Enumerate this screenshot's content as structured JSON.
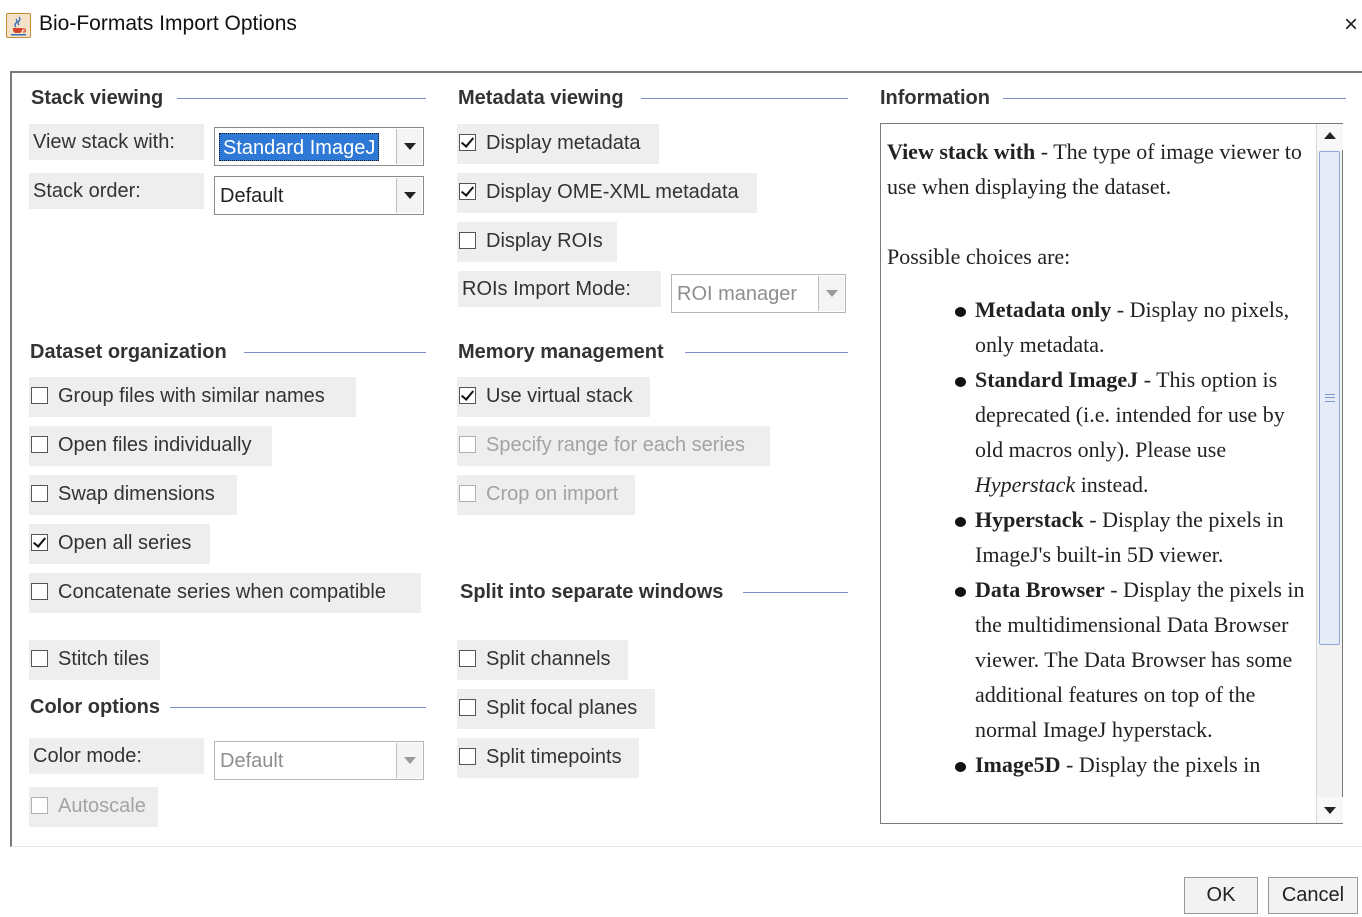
{
  "window": {
    "title": "Bio-Formats Import Options",
    "close_glyph": "×",
    "app_icon": "java-coffee-icon"
  },
  "stack_viewing": {
    "title": "Stack viewing",
    "view_stack_label": "View stack with:",
    "view_stack_value": "Standard ImageJ",
    "stack_order_label": "Stack order:",
    "stack_order_value": "Default"
  },
  "metadata_viewing": {
    "title": "Metadata viewing",
    "display_metadata": {
      "label": "Display metadata",
      "checked": true
    },
    "display_ome_xml": {
      "label": "Display OME-XML metadata",
      "checked": true
    },
    "display_rois": {
      "label": "Display ROIs",
      "checked": false
    },
    "rois_import_mode_label": "ROIs Import Mode:",
    "rois_import_mode_value": "ROI manager"
  },
  "dataset_organization": {
    "title": "Dataset organization",
    "group_files": {
      "label": "Group files with similar names",
      "checked": false
    },
    "open_individually": {
      "label": "Open files individually",
      "checked": false
    },
    "swap_dimensions": {
      "label": "Swap dimensions",
      "checked": false
    },
    "open_all_series": {
      "label": "Open all series",
      "checked": true
    },
    "concatenate": {
      "label": "Concatenate series when compatible",
      "checked": false
    },
    "stitch_tiles": {
      "label": "Stitch tiles",
      "checked": false
    }
  },
  "memory_management": {
    "title": "Memory management",
    "use_virtual_stack": {
      "label": "Use virtual stack",
      "checked": true
    },
    "specify_range": {
      "label": "Specify range for each series",
      "checked": false,
      "enabled": false
    },
    "crop_on_import": {
      "label": "Crop on import",
      "checked": false,
      "enabled": false
    }
  },
  "split_windows": {
    "title": "Split into separate windows",
    "split_channels": {
      "label": "Split channels",
      "checked": false
    },
    "split_focal_planes": {
      "label": "Split focal planes",
      "checked": false
    },
    "split_timepoints": {
      "label": "Split timepoints",
      "checked": false
    }
  },
  "color_options": {
    "title": "Color options",
    "color_mode_label": "Color mode:",
    "color_mode_value": "Default",
    "autoscale": {
      "label": "Autoscale",
      "checked": false,
      "enabled": false
    }
  },
  "information": {
    "title": "Information",
    "heading_term": "View stack with",
    "heading_desc": " - The type of image viewer to use when displaying the dataset.",
    "choices_intro": "Possible choices are:",
    "choices": [
      {
        "term": "Metadata only",
        "desc": " - Display no pixels, only metadata."
      },
      {
        "term": "Standard ImageJ",
        "desc": " - This option is deprecated (i.e. intended for use by old macros only). Please use ",
        "em": "Hyperstack",
        "desc_after": " instead."
      },
      {
        "term": "Hyperstack",
        "desc": " - Display the pixels in ImageJ's built-in 5D viewer."
      },
      {
        "term": "Data Browser",
        "desc": " - Display the pixels in the multidimensional Data Browser viewer. The Data Browser has some additional features on top of the normal ImageJ hyperstack."
      },
      {
        "term": "Image5D",
        "desc": " - Display the pixels in"
      }
    ]
  },
  "buttons": {
    "ok": "OK",
    "cancel": "Cancel"
  },
  "colors": {
    "accent_selection": "#2f79d6",
    "section_line": "#7d8ec9",
    "panel_bg": "#eeeeee"
  }
}
